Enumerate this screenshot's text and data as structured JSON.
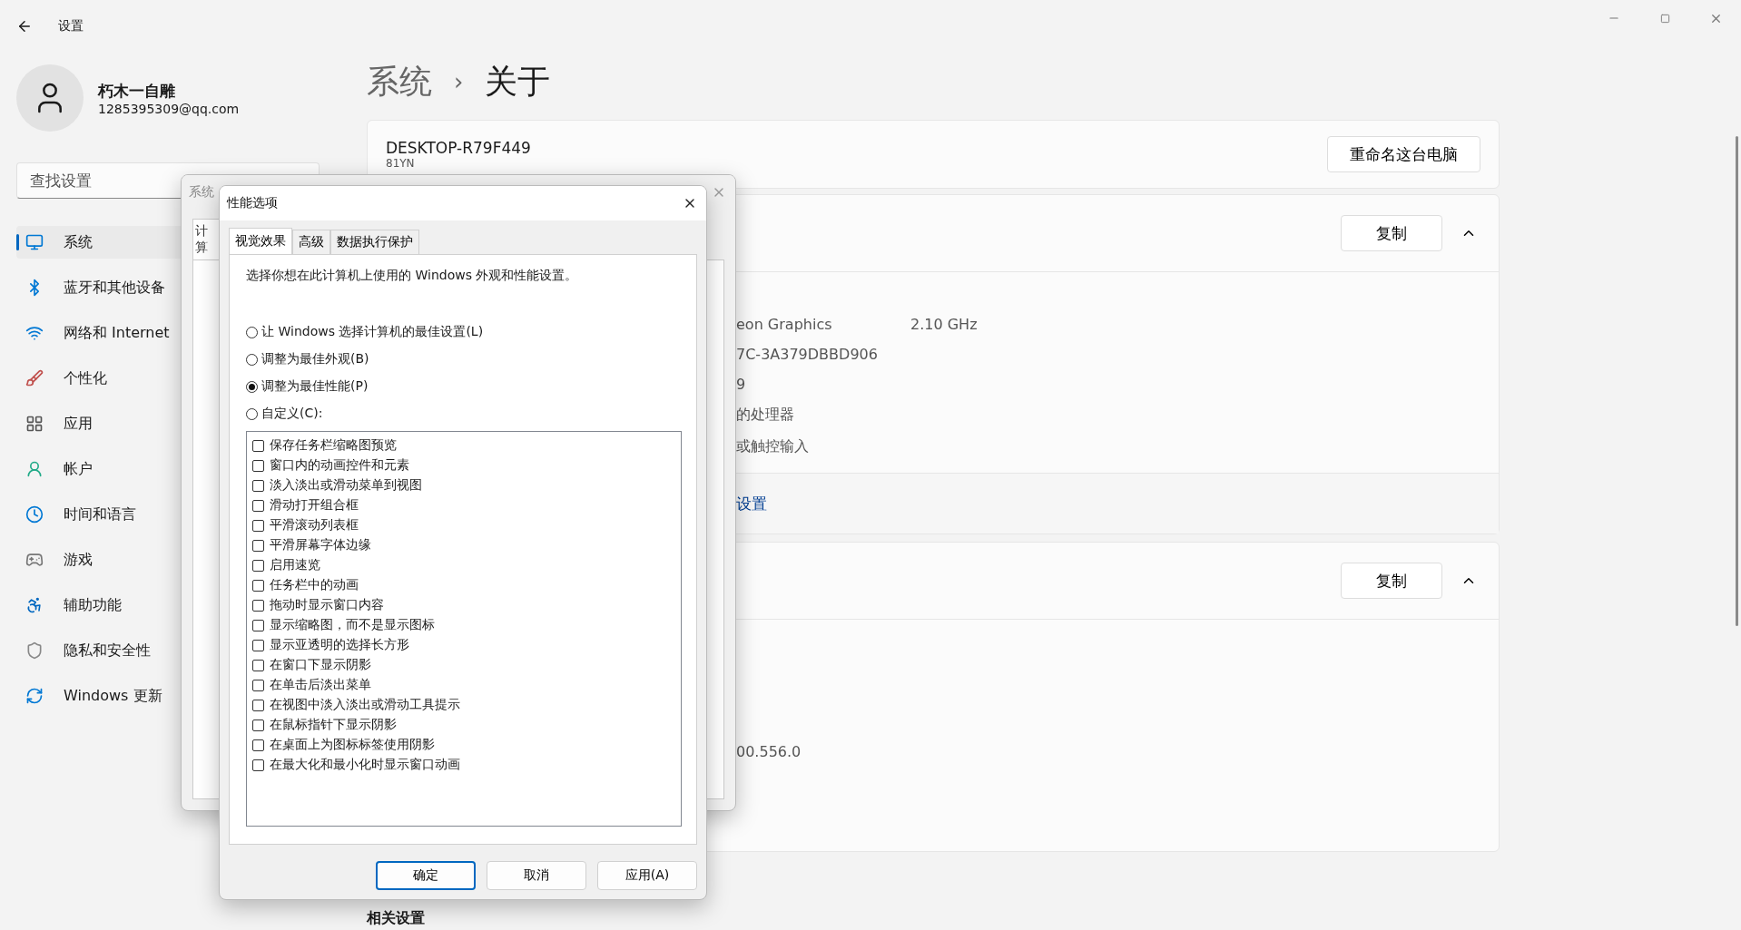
{
  "window": {
    "title": "设置"
  },
  "user": {
    "name": "朽木一自雕",
    "email": "1285395309@qq.com"
  },
  "search": {
    "placeholder": "查找设置"
  },
  "nav": [
    {
      "label": "系统",
      "selected": true
    },
    {
      "label": "蓝牙和其他设备",
      "selected": false
    },
    {
      "label": "网络和 Internet",
      "selected": false
    },
    {
      "label": "个性化",
      "selected": false
    },
    {
      "label": "应用",
      "selected": false
    },
    {
      "label": "帐户",
      "selected": false
    },
    {
      "label": "时间和语言",
      "selected": false
    },
    {
      "label": "游戏",
      "selected": false
    },
    {
      "label": "辅助功能",
      "selected": false
    },
    {
      "label": "隐私和安全性",
      "selected": false
    },
    {
      "label": "Windows 更新",
      "selected": false
    }
  ],
  "breadcrumb": {
    "parent": "系统",
    "separator": "›",
    "current": "关于"
  },
  "device_card": {
    "name": "DESKTOP-R79F449",
    "model": "81YN",
    "button": "重命名这台电脑"
  },
  "spec_card": {
    "button": "复制",
    "expanded": true,
    "rows": [
      [
        "eon Graphics",
        "2.10 GHz"
      ],
      [
        "7C-3A379DBBD906"
      ],
      [
        "9"
      ],
      [
        "的处理器"
      ],
      [
        "或触控输入"
      ]
    ],
    "link": "设置"
  },
  "windows_card": {
    "button": "复制",
    "expanded": true,
    "rows": [
      [
        "00.556.0"
      ]
    ]
  },
  "related": "相关设置",
  "back_dialog": {
    "title": "系统",
    "tab": "计算"
  },
  "dialog": {
    "title": "性能选项",
    "tabs": [
      {
        "label": "视觉效果",
        "selected": true
      },
      {
        "label": "高级",
        "selected": false
      },
      {
        "label": "数据执行保护",
        "selected": false
      }
    ],
    "description": "选择你想在此计算机上使用的 Windows 外观和性能设置。",
    "options": [
      {
        "label": "让 Windows 选择计算机的最佳设置(L)",
        "selected": false
      },
      {
        "label": "调整为最佳外观(B)",
        "selected": false
      },
      {
        "label": "调整为最佳性能(P)",
        "selected": true
      },
      {
        "label": "自定义(C):",
        "selected": false
      }
    ],
    "effects": [
      {
        "label": "保存任务栏缩略图预览",
        "checked": false
      },
      {
        "label": "窗口内的动画控件和元素",
        "checked": false
      },
      {
        "label": "淡入淡出或滑动菜单到视图",
        "checked": false
      },
      {
        "label": "滑动打开组合框",
        "checked": false
      },
      {
        "label": "平滑滚动列表框",
        "checked": false
      },
      {
        "label": "平滑屏幕字体边缘",
        "checked": false
      },
      {
        "label": "启用速览",
        "checked": false
      },
      {
        "label": "任务栏中的动画",
        "checked": false
      },
      {
        "label": "拖动时显示窗口内容",
        "checked": false
      },
      {
        "label": "显示缩略图，而不是显示图标",
        "checked": false
      },
      {
        "label": "显示亚透明的选择长方形",
        "checked": false
      },
      {
        "label": "在窗口下显示阴影",
        "checked": false
      },
      {
        "label": "在单击后淡出菜单",
        "checked": false
      },
      {
        "label": "在视图中淡入淡出或滑动工具提示",
        "checked": false
      },
      {
        "label": "在鼠标指针下显示阴影",
        "checked": false
      },
      {
        "label": "在桌面上为图标标签使用阴影",
        "checked": false
      },
      {
        "label": "在最大化和最小化时显示窗口动画",
        "checked": false
      }
    ],
    "buttons": [
      {
        "label": "确定",
        "primary": true
      },
      {
        "label": "取消",
        "primary": false
      },
      {
        "label": "应用(A)",
        "primary": false
      }
    ]
  }
}
